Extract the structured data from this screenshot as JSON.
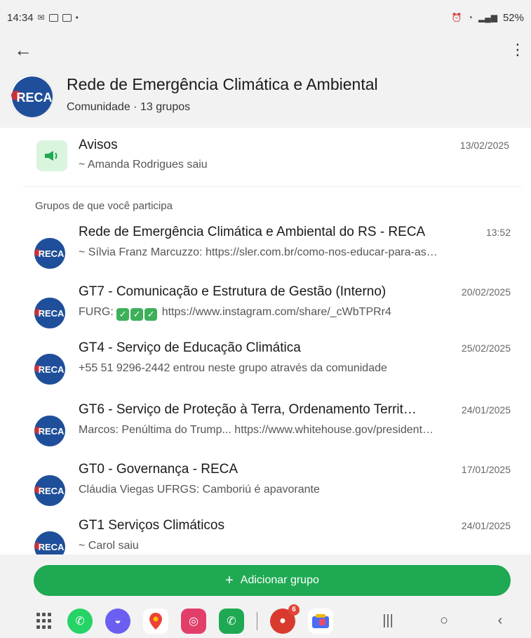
{
  "status_bar": {
    "time": "14:34",
    "battery": "52%"
  },
  "header": {
    "community_name": "Rede de Emergência Climática e Ambiental",
    "community_subtitle": "Comunidade · 13 grupos",
    "logo_text": "RECA"
  },
  "announcements": {
    "name": "Avisos",
    "date": "13/02/2025",
    "message": "~ Amanda Rodrigues saiu"
  },
  "section_label": "Grupos de que você participa",
  "groups": [
    {
      "name": "Rede de Emergência Climática e Ambiental do RS - RECA",
      "time": "13:52",
      "message": "~ Sílvia Franz Marcuzzo: https://sler.com.br/como-nos-educar-para-as…"
    },
    {
      "name": "GT7 - Comunicação e Estrutura de Gestão (Interno)",
      "time": "20/02/2025",
      "message_prefix": "FURG:",
      "message": "https://www.instagram.com/share/_cWbTPRr4"
    },
    {
      "name": "GT4 - Serviço de Educação Climática",
      "time": "25/02/2025",
      "message": "+55 51 9296-2442 entrou neste grupo através da comunidade"
    },
    {
      "name": "GT6 - Serviço de Proteção à Terra, Ordenamento Territ…",
      "time": "24/01/2025",
      "message": "Marcos: Penúltima do Trump... https://www.whitehouse.gov/president…"
    },
    {
      "name": "GT0 - Governança - RECA",
      "time": "17/01/2025",
      "message": "Cláudia Viegas UFRGS: Camboriú é apavorante"
    },
    {
      "name": "GT1 Serviços Climáticos",
      "time": "24/01/2025",
      "message": "~ Carol saiu"
    }
  ],
  "add_group_button": {
    "label": "Adicionar grupo"
  },
  "nav_bar": {
    "dock_badge": "6",
    "apps": [
      "whatsapp-icon",
      "samsung-internet-icon",
      "maps-icon",
      "instagram-icon",
      "phone-icon",
      "app-with-badge-icon",
      "store-icon"
    ],
    "colors": {
      "whatsapp": "#25d366",
      "internet": "#6a5ff0",
      "instagram": "#e23e6a",
      "phone": "#1ea952",
      "accent": "#1ea952"
    }
  }
}
